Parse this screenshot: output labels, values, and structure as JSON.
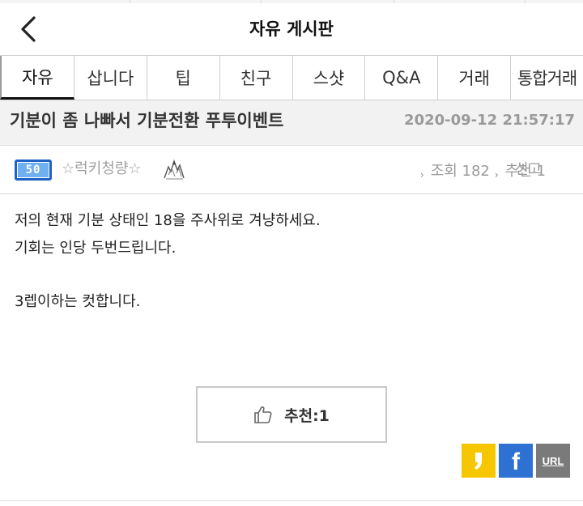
{
  "header": {
    "title": "자유 게시판",
    "back_icon": "chevron-left-icon"
  },
  "tabs": [
    {
      "label": "자유",
      "active": true
    },
    {
      "label": "삽니다",
      "active": false
    },
    {
      "label": "팁",
      "active": false
    },
    {
      "label": "친구",
      "active": false
    },
    {
      "label": "스샷",
      "active": false
    },
    {
      "label": "Q&A",
      "active": false
    },
    {
      "label": "거래",
      "active": false
    },
    {
      "label": "통합거래",
      "active": false
    }
  ],
  "post": {
    "title": "기분이 좀 나빠서 기분전환 푸투이벤트",
    "date": "2020-09-12 21:57:17",
    "author": {
      "level": "50",
      "level_badge_color": "#1f62c4",
      "nickname": "☆럭키청량☆"
    },
    "stats": {
      "views": "조회 182",
      "recommends": "추천 1",
      "report_label": "신고"
    },
    "body": [
      "저의 현재 기분 상태인 18을 주사위로 겨냥하세요.",
      "기회는 인당 두번드립니다.",
      "3렙이하는 컷합니다."
    ]
  },
  "recommend_button": {
    "label": "추천:1",
    "icon": "thumbs-up-icon"
  },
  "share": {
    "kakao": {
      "icon": "kakaostory-icon",
      "color": "#f6c700"
    },
    "facebook": {
      "icon": "facebook-icon",
      "glyph": "f",
      "color": "#2d72d2"
    },
    "url": {
      "icon": "url-icon",
      "label": "URL",
      "color": "#7a7a7a"
    }
  }
}
